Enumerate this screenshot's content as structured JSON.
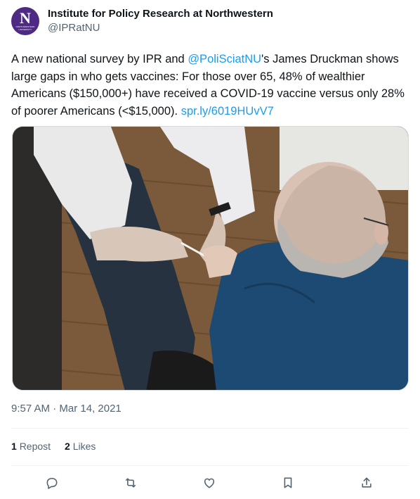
{
  "tweet": {
    "author": {
      "display_name": "Institute for Policy Research at Northwestern",
      "handle": "@IPRatNU",
      "avatar_letter": "N",
      "avatar_subtext": "NORTHWESTERN UNIVERSITY"
    },
    "text": {
      "part1": "A new national survey by IPR and ",
      "mention": "@PoliSciatNU",
      "part2": "'s James Druckman shows large gaps in who gets vaccines: For those over 65, 48% of wealthier Americans ($150,000+) have received a COVID-19 vaccine versus only 28% of poorer Americans (<$15,000). ",
      "link": "spr.ly/6019HUvV7"
    },
    "media": {
      "icon": "photo-vaccination"
    },
    "time": "9:57 AM",
    "separator": "·",
    "date": "Mar 14, 2021",
    "stats": {
      "reposts_count": "1",
      "reposts_label": "Repost",
      "likes_count": "2",
      "likes_label": "Likes"
    },
    "actions": [
      "reply-icon",
      "repost-icon",
      "like-icon",
      "bookmark-icon",
      "share-icon"
    ]
  },
  "colors": {
    "avatar_bg": "#4e2a84",
    "link": "#1d9bf0",
    "muted": "#536471"
  }
}
